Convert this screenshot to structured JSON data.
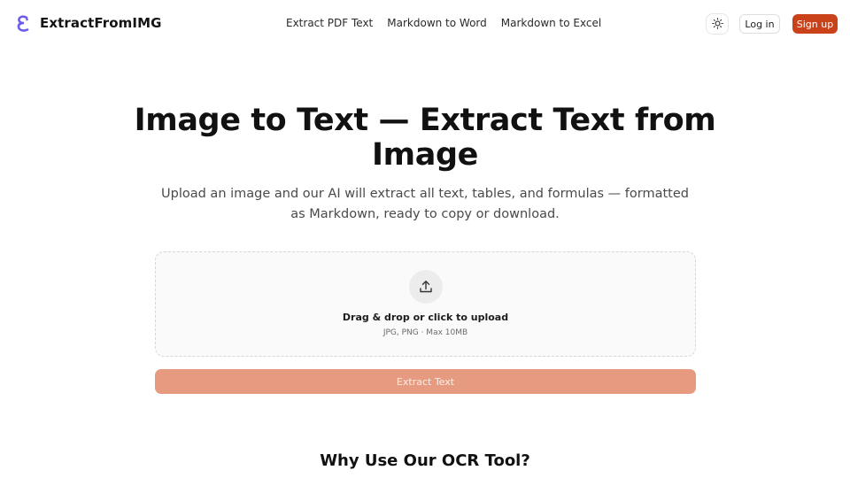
{
  "header": {
    "brand": "ExtractFromIMG",
    "logo_icon": "logo-icon",
    "nav": [
      {
        "label": "Extract PDF Text"
      },
      {
        "label": "Markdown to Word"
      },
      {
        "label": "Markdown to Excel"
      }
    ],
    "theme_icon": "sun-icon",
    "login_label": "Log in",
    "signup_label": "Sign up"
  },
  "hero": {
    "title": "Image to Text — Extract Text from Image",
    "subtitle": "Upload an image and our AI will extract all text, tables, and formulas — formatted as Markdown, ready to copy or download."
  },
  "upload": {
    "icon": "upload-icon",
    "title": "Drag & drop or click to upload",
    "hint": "JPG, PNG · Max 10MB"
  },
  "actions": {
    "extract_label": "Extract Text"
  },
  "section": {
    "title": "Why Use Our OCR Tool?"
  },
  "colors": {
    "accent": "#c9421a",
    "extract_button": "#e69b80",
    "logo": "#6d5ce8"
  }
}
